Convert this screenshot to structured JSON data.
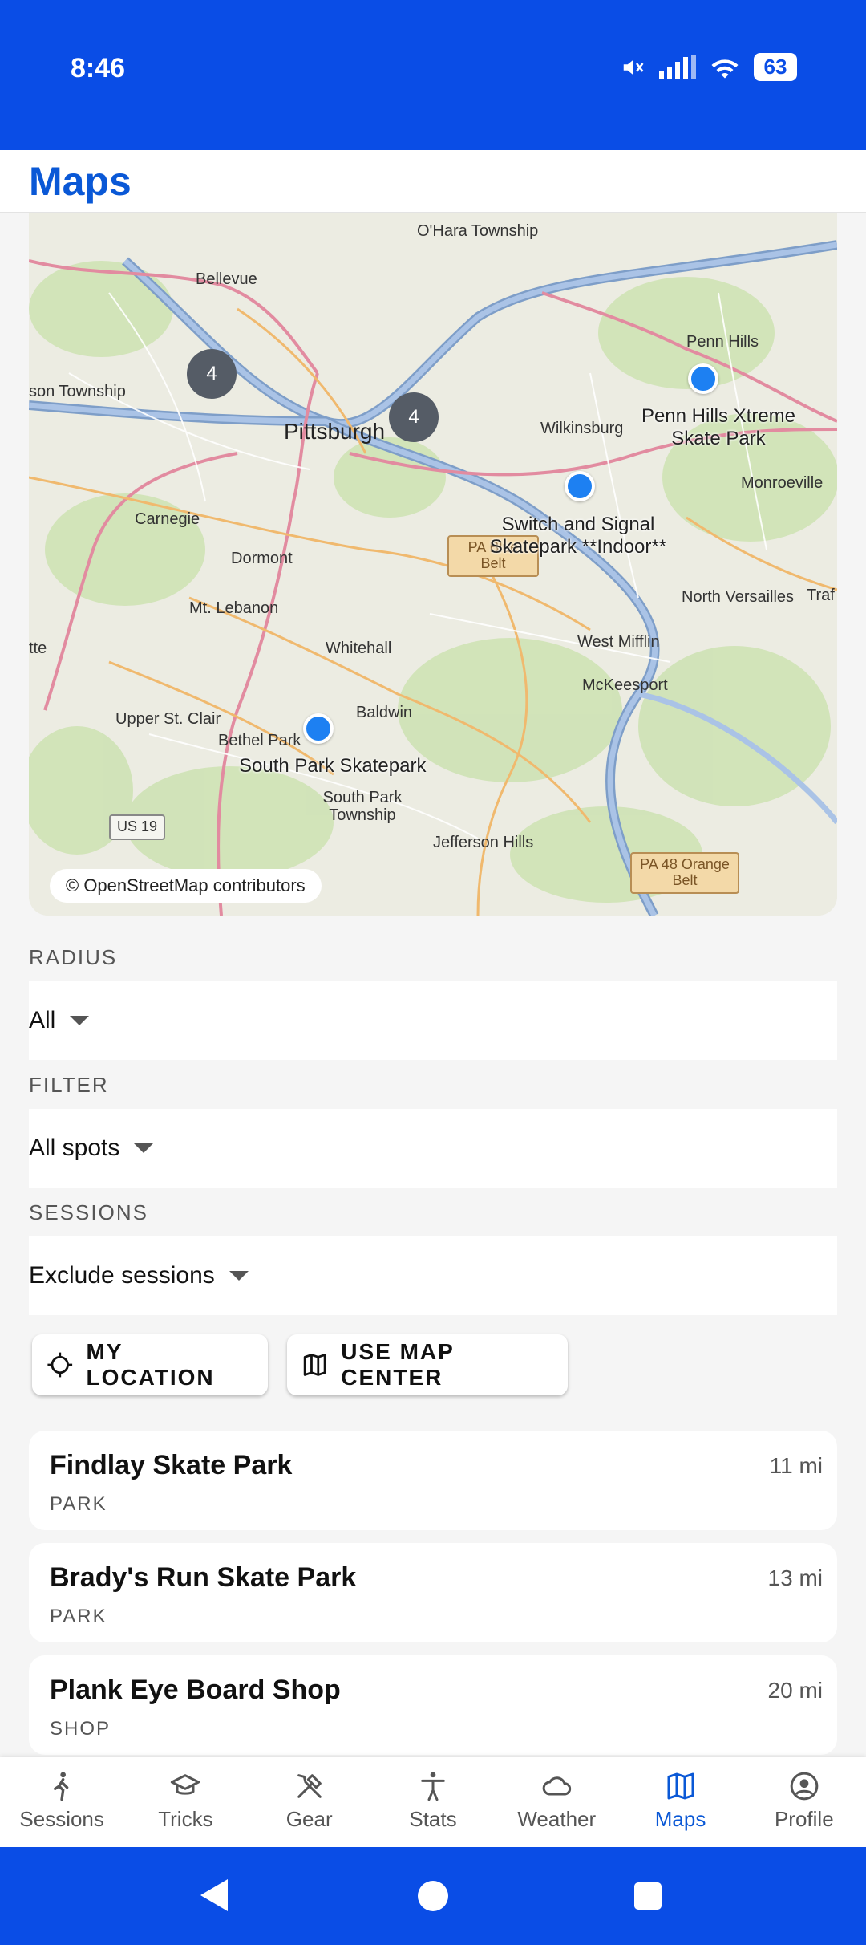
{
  "status_bar": {
    "time": "8:46",
    "battery": "63"
  },
  "header": {
    "title": "Maps"
  },
  "map": {
    "attribution": "© OpenStreetMap contributors",
    "places": [
      "O'Hara Township",
      "Bellevue",
      "Penn Hills",
      "son Township",
      "Pittsburgh",
      "Wilkinsburg",
      "Monroeville",
      "Carnegie",
      "Dormont",
      "North Versailles",
      "Mt. Lebanon",
      "Whitehall",
      "West Mifflin",
      "McKeesport",
      "Upper St. Clair",
      "Baldwin",
      "Bethel Park",
      "South Park Township",
      "Jefferson Hills",
      "tte",
      "Traf"
    ],
    "clusters": [
      "4",
      "4"
    ],
    "spots": [
      "Penn Hills Xtreme Skate Park",
      "Switch and Signal Skatepark **Indoor**",
      "South Park Skatepark"
    ],
    "signs": {
      "blue_belt": "PA Blue Belt",
      "orange_belt": "PA 48 Orange Belt",
      "us19": "US 19"
    }
  },
  "filters": {
    "radius": {
      "label": "RADIUS",
      "value": "All"
    },
    "filter": {
      "label": "FILTER",
      "value": "All spots"
    },
    "sessions": {
      "label": "SESSIONS",
      "value": "Exclude sessions"
    }
  },
  "buttons": {
    "my_location": "MY LOCATION",
    "use_map_center": "USE MAP CENTER"
  },
  "spots": [
    {
      "name": "Findlay Skate Park",
      "type": "PARK",
      "distance": "11 mi"
    },
    {
      "name": "Brady's Run Skate Park",
      "type": "PARK",
      "distance": "13 mi"
    },
    {
      "name": "Plank Eye Board Shop",
      "type": "SHOP",
      "distance": "20 mi"
    }
  ],
  "nav": {
    "active": "Maps",
    "items": [
      "Sessions",
      "Tricks",
      "Gear",
      "Stats",
      "Weather",
      "Maps",
      "Profile"
    ]
  },
  "colors": {
    "brand": "#0a4de6",
    "accent": "#0a58d6",
    "marker": "#1d80f2"
  }
}
